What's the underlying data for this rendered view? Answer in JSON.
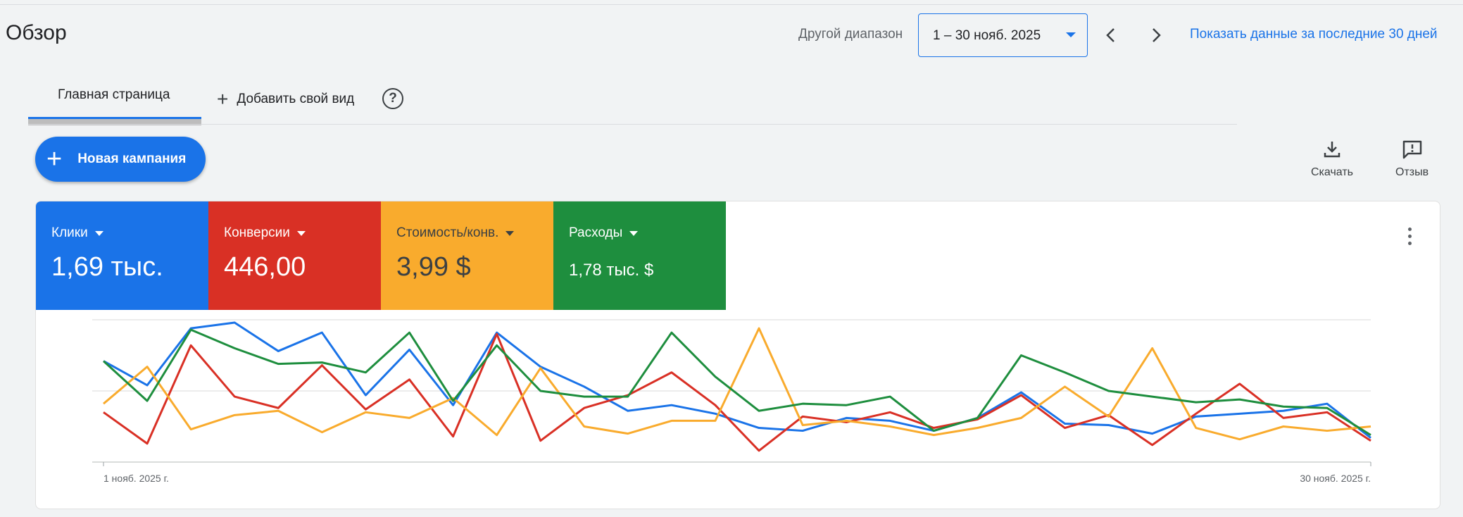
{
  "header": {
    "title": "Обзор",
    "range_label": "Другой диапазон",
    "date_value": "1 – 30 нояб. 2025",
    "last30_link": "Показать данные за последние 30 дней"
  },
  "tabs": {
    "home": "Главная страница",
    "add_view": "Добавить свой вид"
  },
  "actions": {
    "new_campaign": "Новая кампания",
    "download": "Скачать",
    "feedback": "Отзыв"
  },
  "metrics": [
    {
      "name": "Клики",
      "value": "1,69 тыс.",
      "color": "#1a73e8"
    },
    {
      "name": "Конверсии",
      "value": "446,00",
      "color": "#d93025"
    },
    {
      "name": "Стоимость/конв.",
      "value": "3,99 $",
      "color": "#f9ab2d"
    },
    {
      "name": "Расходы",
      "value": "1,78 тыс. $",
      "color": "#1e8e3e"
    }
  ],
  "chart_data": {
    "type": "line",
    "x_start_label": "1 нояб. 2025 г.",
    "x_end_label": "30 нояб. 2025 г.",
    "x": [
      1,
      2,
      3,
      4,
      5,
      6,
      7,
      8,
      9,
      10,
      11,
      12,
      13,
      14,
      15,
      16,
      17,
      18,
      19,
      20,
      21,
      22,
      23,
      24,
      25,
      26,
      27,
      28,
      29,
      30
    ],
    "ylim": [
      0,
      100
    ],
    "grid": true,
    "series": [
      {
        "color": "#1a73e8",
        "values": [
          71,
          54,
          94,
          98,
          78,
          91,
          47,
          79,
          40,
          91,
          67,
          53,
          36,
          40,
          34,
          24,
          22,
          31,
          29,
          22,
          31,
          49,
          27,
          26,
          20,
          32,
          34,
          36,
          41,
          17
        ]
      },
      {
        "color": "#d93025",
        "values": [
          35,
          13,
          82,
          46,
          38,
          68,
          37,
          58,
          18,
          90,
          15,
          38,
          47,
          63,
          40,
          8,
          32,
          28,
          35,
          24,
          30,
          47,
          24,
          33,
          12,
          34,
          55,
          31,
          35,
          15
        ]
      },
      {
        "color": "#f9ab2d",
        "values": [
          41,
          67,
          23,
          33,
          36,
          21,
          35,
          31,
          45,
          19,
          66,
          25,
          20,
          29,
          29,
          94,
          26,
          29,
          25,
          19,
          24,
          31,
          53,
          32,
          80,
          24,
          16,
          25,
          22,
          25
        ]
      },
      {
        "color": "#1e8e3e",
        "values": [
          71,
          43,
          93,
          80,
          69,
          70,
          63,
          91,
          43,
          82,
          50,
          46,
          46,
          91,
          60,
          36,
          41,
          40,
          46,
          22,
          31,
          75,
          63,
          50,
          46,
          42,
          44,
          39,
          38,
          19
        ]
      }
    ]
  }
}
